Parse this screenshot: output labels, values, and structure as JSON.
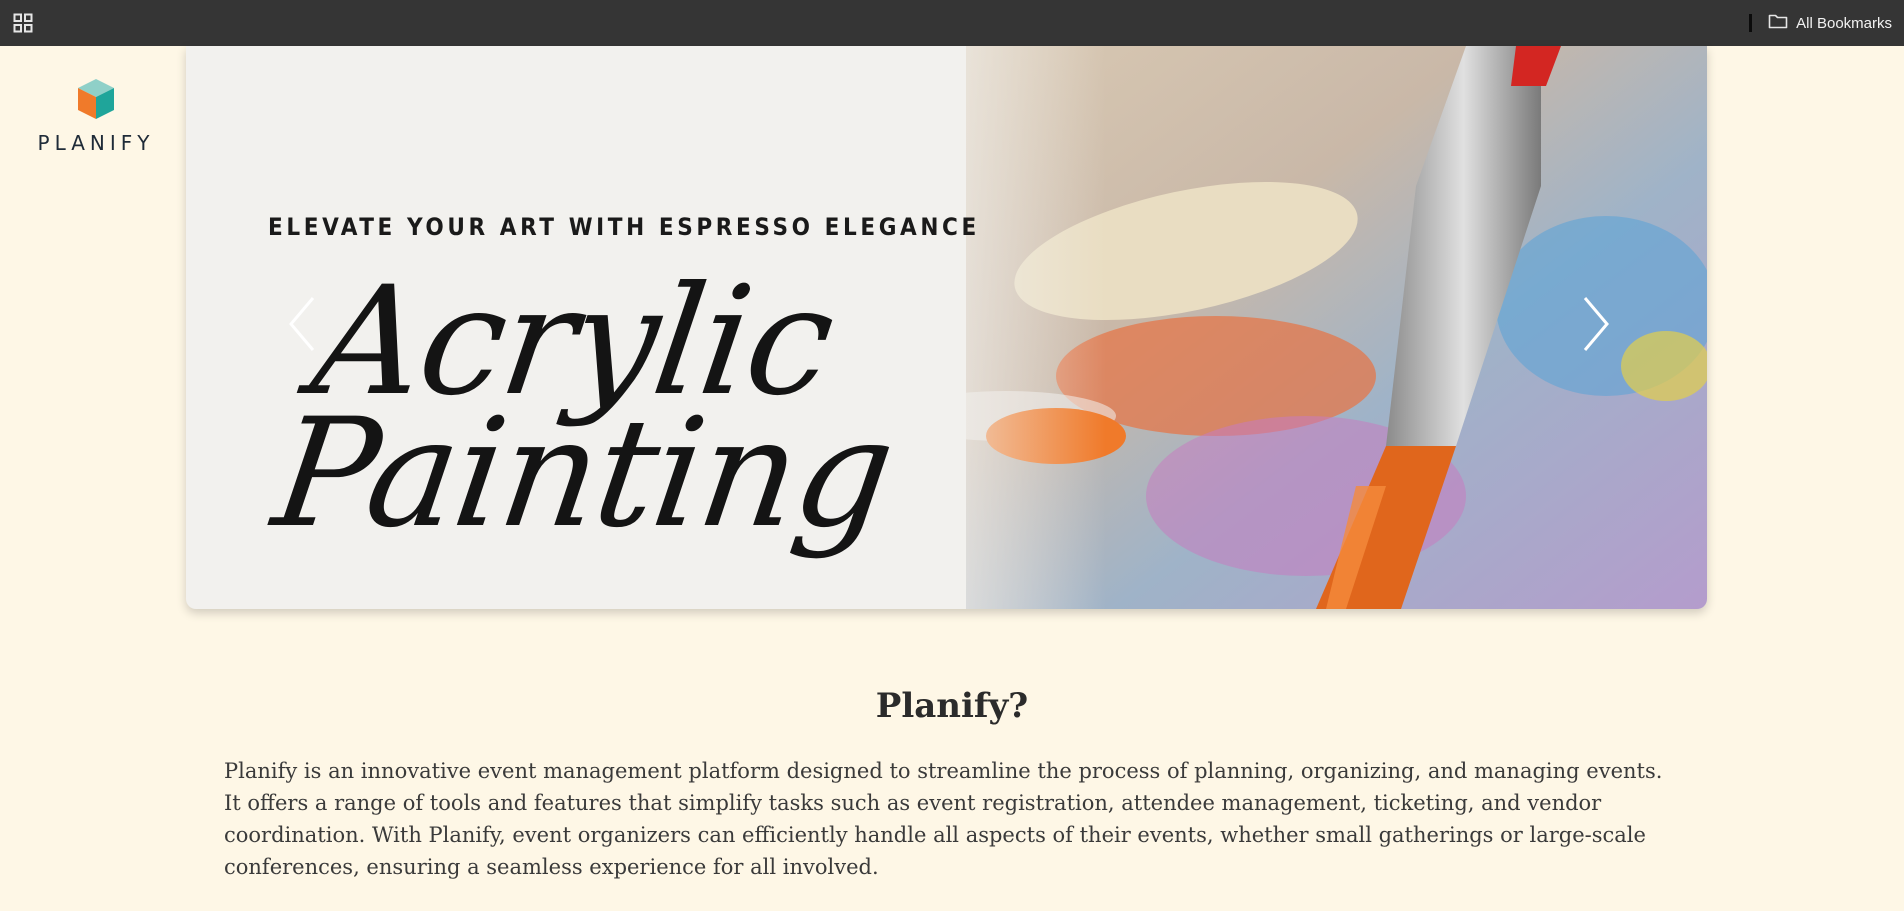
{
  "bookmarks_bar": {
    "apps_icon": "apps-grid-icon",
    "folder_icon": "folder-icon",
    "all_bookmarks_label": "All Bookmarks"
  },
  "brand": {
    "logo_icon": "cube-logo-icon",
    "name": "PLANIFY"
  },
  "carousel": {
    "slide": {
      "tagline": "ELEVATE YOUR ART WITH ESPRESSO ELEGANCE",
      "title_line1": "Acrylic",
      "title_line2": "Painting"
    },
    "prev_icon": "chevron-left-icon",
    "next_icon": "chevron-right-icon"
  },
  "about": {
    "title": "Planify?",
    "body": "Planify is an innovative event management platform designed to streamline the process of planning, organizing, and managing events. It offers a range of tools and features that simplify tasks such as event registration, attendee management, ticketing, and vendor coordination. With Planify, event organizers can efficiently handle all aspects of their events, whether small gatherings or large-scale conferences, ensuring a seamless experience for all involved."
  },
  "colors": {
    "page_bg": "#fef7e6",
    "bar_bg": "#353535",
    "logo_orange": "#f07a2a",
    "logo_teal": "#1fa59a"
  }
}
